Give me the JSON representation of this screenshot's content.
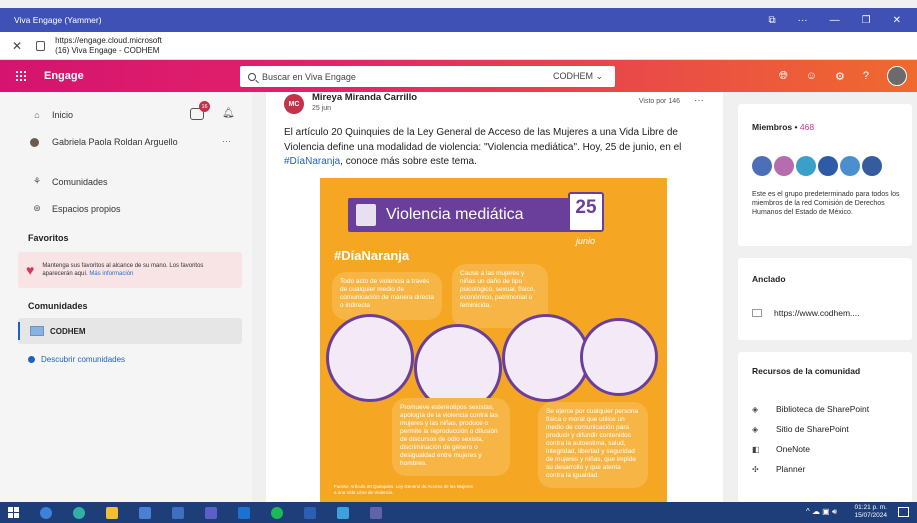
{
  "browser": {
    "window_title": "Viva Engage (Yammer)",
    "url_line1": "https://engage.cloud.microsoft",
    "url_line2": "(16) Viva Engage - CODHEM"
  },
  "appbar": {
    "brand": "Engage",
    "search_placeholder": "Buscar en Viva Engage",
    "scope": "CODHEM"
  },
  "sidebar": {
    "home": "Inicio",
    "notif_badge": "16",
    "user_name": "Gabriela Paola Roldan Arguello",
    "communities_link": "Comunidades",
    "own_spaces": "Espacios propios",
    "favorites_heading": "Favoritos",
    "favorites_text": "Mantenga sus favoritos al alcance de su mano. Los favoritos aparecerán aquí.",
    "favorites_more": "Más información",
    "communities_heading": "Comunidades",
    "community_name": "CODHEM",
    "discover": "Descubrir comunidades"
  },
  "post": {
    "avatar_initials": "MC",
    "author": "Mireya Miranda Carrillo",
    "date": "25 jun",
    "views": "Visto por 146",
    "text_before": "El artículo 20 Quinquies de la Ley General de Acceso de las Mujeres a una Vida Libre de Violencia define una modalidad de violencia: \"Violencia mediática\". Hoy, 25 de junio, en el ",
    "hashtag": "#DíaNaranja",
    "text_after": ", conoce más sobre este tema."
  },
  "infographic": {
    "title": "Violencia mediática",
    "day": "25",
    "month": "junio",
    "hashtag": "#DíaNaranja",
    "bubble1": "Todo acto de violencia a través de cualquier medio de comunicación de manera directa o indirecta",
    "bubble2": "Cause a las mujeres y niñas un daño de tipo psicológico, sexual, físico, económico, patrimonial o feminicida.",
    "bubble3": "Promueve estereotipos sexistas, apología de la violencia contra las mujeres y las niñas, produce o permite la reproducción o difusión de discursos de odio sexista, discriminación de género o desigualdad entre mujeres y hombres.",
    "bubble4": "Se ejerce por cualquier persona física o moral que utilice un medio de comunicación para producir y difundir contenidos contra la autoestima, salud, integridad, libertad y seguridad de mujeres y niñas, que impide su desarrollo y que atenta contra la igualdad.",
    "source": "Fuente: Artículo 20 Quinquies. Ley General de Acceso de las Mujeres a una Vida Libre de Violencia."
  },
  "right": {
    "members_heading": "Miembros",
    "members_count": "468",
    "members_desc": "Este es el grupo predeterminado para todos los miembros de la red Comisión de Derechos Humanos del Estado de México.",
    "pinned_heading": "Anclado",
    "pinned_link": "https://www.codhem....",
    "resources_heading": "Recursos de la comunidad",
    "resources": [
      "Biblioteca de SharePoint",
      "Sitio de SharePoint",
      "OneNote",
      "Planner"
    ]
  },
  "taskbar": {
    "time": "01:21 p. m.",
    "date": "15/07/2024"
  },
  "colors": {
    "appbar_start": "#d4146e",
    "appbar_end": "#ef6a2e",
    "infographic_bg": "#f5a623",
    "infographic_purple": "#6a3f9b",
    "link_blue": "#1f62c1"
  }
}
